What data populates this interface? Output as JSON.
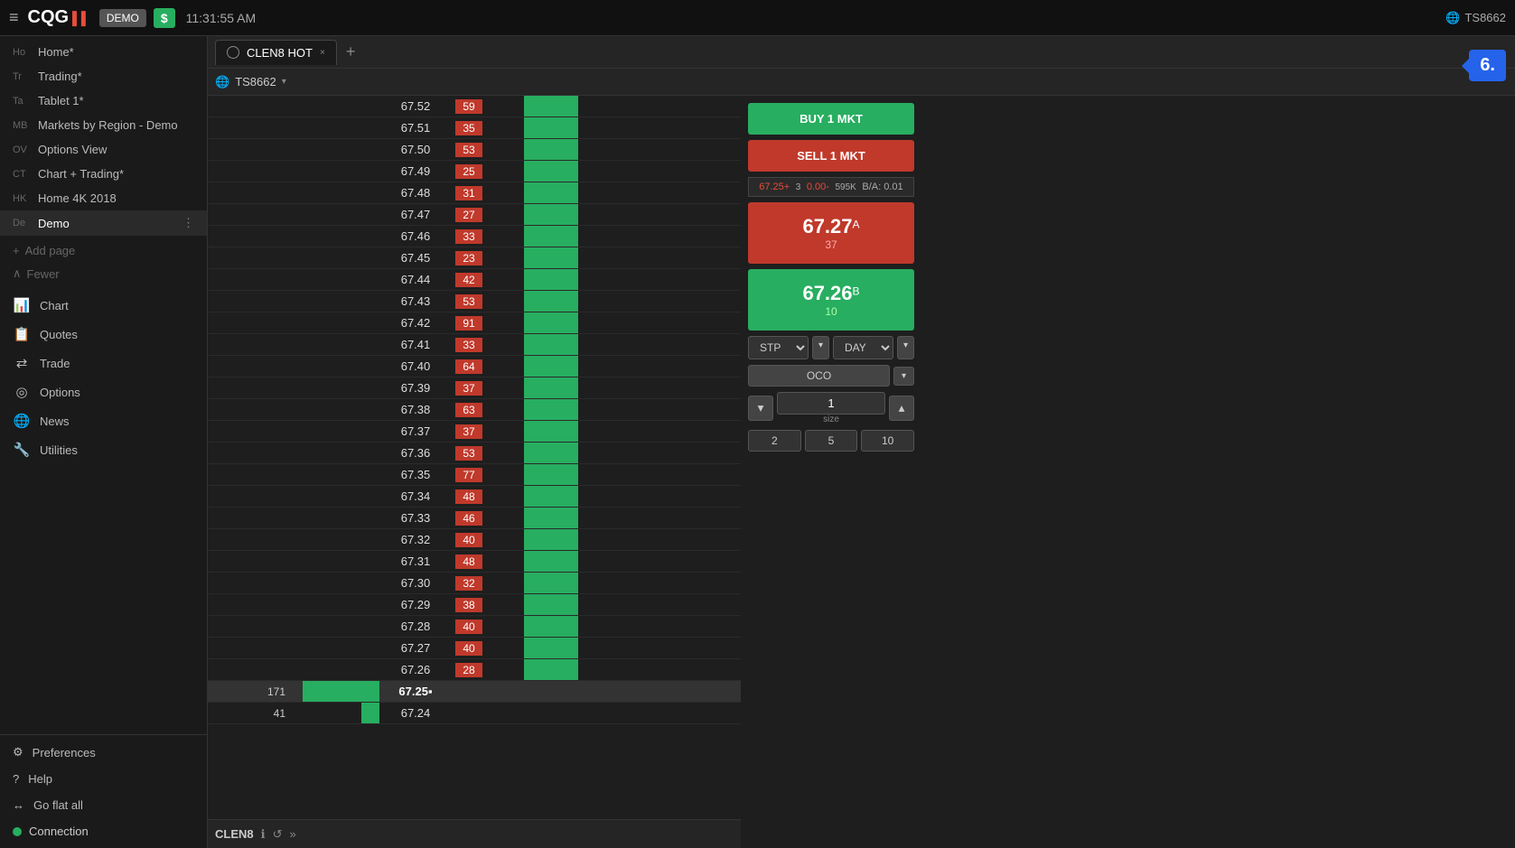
{
  "topbar": {
    "menu_icon": "≡",
    "logo": "CQG",
    "demo_label": "DEMO",
    "dollar_sign": "$",
    "time": "11:31:55 AM",
    "user": "TS8662",
    "notification_count": "6."
  },
  "sidebar": {
    "nav_items": [
      {
        "code": "Ho",
        "label": "Home*"
      },
      {
        "code": "Tr",
        "label": "Trading*"
      },
      {
        "code": "Ta",
        "label": "Tablet 1*"
      },
      {
        "code": "MB",
        "label": "Markets by Region - Demo"
      },
      {
        "code": "OV",
        "label": "Options View"
      },
      {
        "code": "CT",
        "label": "Chart + Trading*"
      },
      {
        "code": "HK",
        "label": "Home 4K 2018"
      },
      {
        "code": "De",
        "label": "Demo",
        "active": true
      }
    ],
    "add_page": "+ Add page",
    "fewer": "Fewer",
    "tools": [
      {
        "icon": "📊",
        "label": "Chart"
      },
      {
        "icon": "📋",
        "label": "Quotes"
      },
      {
        "icon": "⇄",
        "label": "Trade"
      },
      {
        "icon": "◎",
        "label": "Options"
      },
      {
        "icon": "🌐",
        "label": "News"
      },
      {
        "icon": "🔧",
        "label": "Utilities"
      }
    ],
    "bottom": [
      {
        "icon": "⚙",
        "label": "Preferences"
      },
      {
        "icon": "?",
        "label": "Help"
      },
      {
        "icon": "↔",
        "label": "Go flat all"
      }
    ],
    "connection_label": "Connection",
    "connection_color": "#27ae60"
  },
  "tab": {
    "title": "CLEN8 HOT",
    "close": "×",
    "add": "+"
  },
  "account": {
    "name": "TS8662",
    "arrow": "▾"
  },
  "ladder": {
    "rows": [
      {
        "price": "67.52",
        "ask": "59",
        "bid": ""
      },
      {
        "price": "67.51",
        "ask": "35",
        "bid": ""
      },
      {
        "price": "67.50",
        "ask": "53",
        "bid": ""
      },
      {
        "price": "67.49",
        "ask": "25",
        "bid": ""
      },
      {
        "price": "67.48",
        "ask": "31",
        "bid": ""
      },
      {
        "price": "67.47",
        "ask": "27",
        "bid": ""
      },
      {
        "price": "67.46",
        "ask": "33",
        "bid": ""
      },
      {
        "price": "67.45",
        "ask": "23",
        "bid": ""
      },
      {
        "price": "67.44",
        "ask": "42",
        "bid": ""
      },
      {
        "price": "67.43",
        "ask": "53",
        "bid": ""
      },
      {
        "price": "67.42",
        "ask": "91",
        "bid": ""
      },
      {
        "price": "67.41",
        "ask": "33",
        "bid": ""
      },
      {
        "price": "67.40",
        "ask": "64",
        "bid": ""
      },
      {
        "price": "67.39",
        "ask": "37",
        "bid": ""
      },
      {
        "price": "67.38",
        "ask": "63",
        "bid": ""
      },
      {
        "price": "67.37",
        "ask": "37",
        "bid": ""
      },
      {
        "price": "67.36",
        "ask": "53",
        "bid": ""
      },
      {
        "price": "67.35",
        "ask": "77",
        "bid": ""
      },
      {
        "price": "67.34",
        "ask": "48",
        "bid": ""
      },
      {
        "price": "67.33",
        "ask": "46",
        "bid": ""
      },
      {
        "price": "67.32",
        "ask": "40",
        "bid": ""
      },
      {
        "price": "67.31",
        "ask": "48",
        "bid": ""
      },
      {
        "price": "67.30",
        "ask": "32",
        "bid": ""
      },
      {
        "price": "67.29",
        "ask": "38",
        "bid": ""
      },
      {
        "price": "67.28",
        "ask": "40",
        "bid": ""
      },
      {
        "price": "67.27",
        "ask": "40",
        "bid": ""
      },
      {
        "price": "67.26",
        "ask": "28",
        "bid": ""
      },
      {
        "price": "67.25",
        "ask": "",
        "bid": "171",
        "current": true
      },
      {
        "price": "67.24",
        "ask": "",
        "bid": "41"
      }
    ]
  },
  "order_panel": {
    "buy_label": "BUY 1 MKT",
    "sell_label": "SELL 1 MKT",
    "ask_price": "67.27",
    "ask_letter": "A",
    "ask_qty": "37",
    "bid_price": "67.26",
    "bid_letter": "B",
    "bid_qty": "10",
    "mid_bid": "67.25+",
    "mid_ask": "0.00-",
    "mid_qty1": "3",
    "mid_qty2": "595K",
    "spread": "B/A: 0.01",
    "order_type": "STP",
    "time_type": "DAY",
    "oco_label": "OCO",
    "size_value": "1",
    "size_label": "size",
    "preset_2": "2",
    "preset_5": "5",
    "preset_10": "10"
  },
  "footer": {
    "symbol": "CLEN8",
    "info_icon": "ℹ",
    "refresh_icon": "↺",
    "expand_icon": "»"
  }
}
